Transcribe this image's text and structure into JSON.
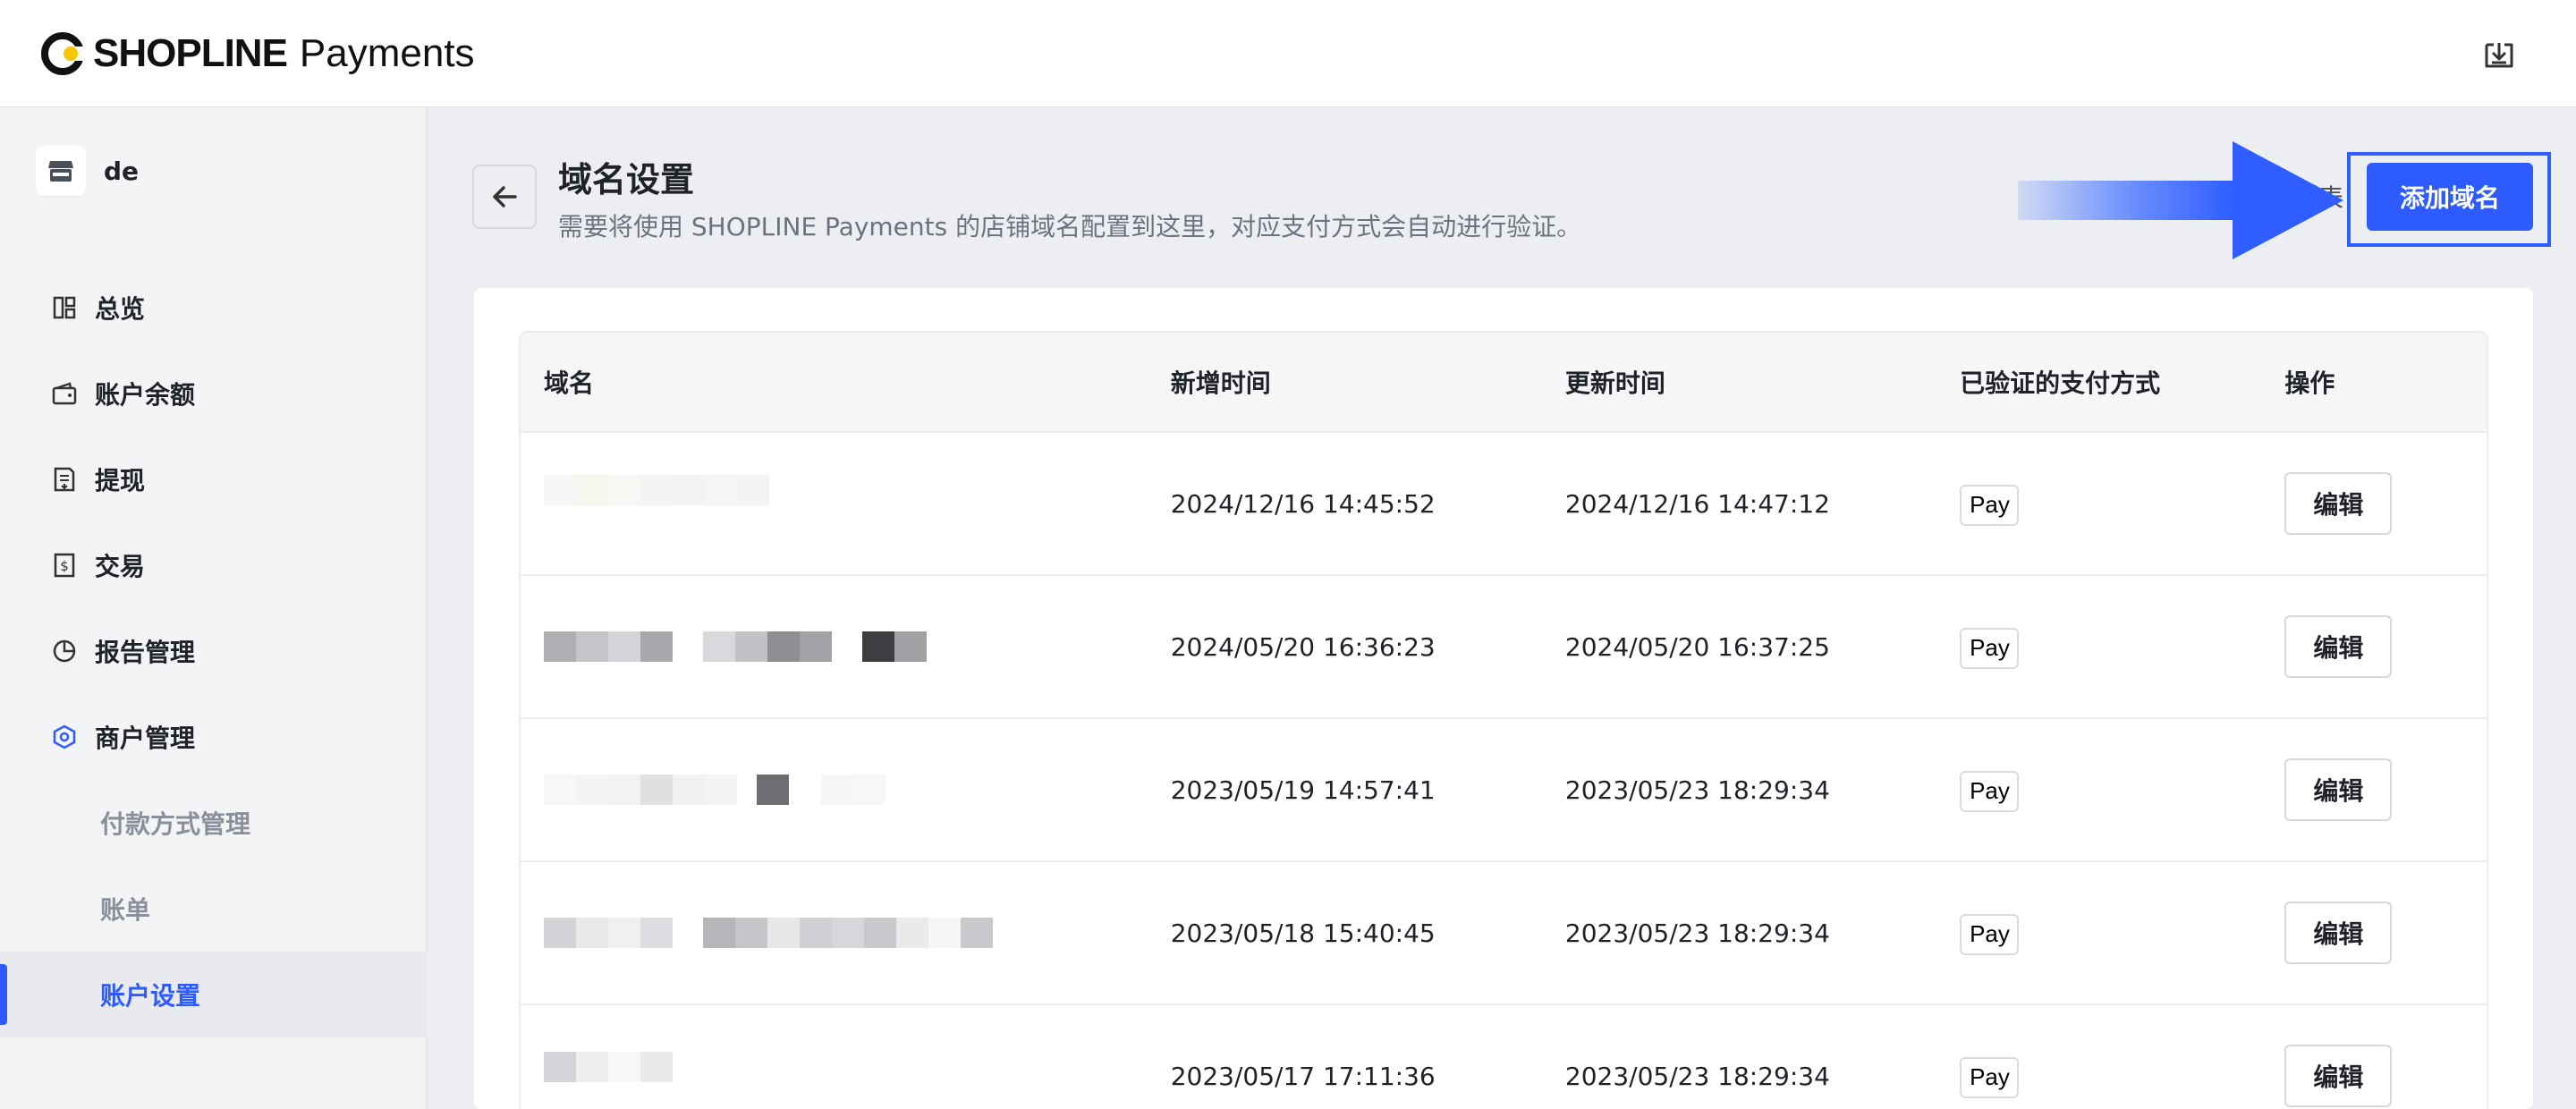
{
  "header": {
    "brand_bold": "SHOPLINE",
    "brand_light": "Payments",
    "export_icon": "download-tray-icon"
  },
  "sidebar": {
    "store_name": "de",
    "items": [
      {
        "label": "总览",
        "icon": "dashboard-icon"
      },
      {
        "label": "账户余额",
        "icon": "wallet-icon"
      },
      {
        "label": "提现",
        "icon": "withdraw-icon"
      },
      {
        "label": "交易",
        "icon": "dollar-receipt-icon"
      },
      {
        "label": "报告管理",
        "icon": "pie-chart-icon"
      },
      {
        "label": "商户管理",
        "icon": "hexagon-gear-icon"
      }
    ],
    "sub_items": [
      {
        "label": "付款方式管理"
      },
      {
        "label": "账单"
      },
      {
        "label": "账户设置",
        "active": true
      }
    ]
  },
  "page": {
    "title": "域名设置",
    "description": "需要将使用 SHOPLINE Payments 的店铺域名配置到这里，对应支付方式会自动进行验证。",
    "list_link": "F列表",
    "add_button": "添加域名"
  },
  "table": {
    "columns": [
      "域名",
      "新增时间",
      "更新时间",
      "已验证的支付方式",
      "操作"
    ],
    "rows": [
      {
        "domain": "",
        "created": "2024/12/16 14:45:52",
        "updated": "2024/12/16 14:47:12",
        "payment": "Pay",
        "action": "编辑"
      },
      {
        "domain": "",
        "created": "2024/05/20 16:36:23",
        "updated": "2024/05/20 16:37:25",
        "payment": "Pay",
        "action": "编辑"
      },
      {
        "domain": "",
        "created": "2023/05/19 14:57:41",
        "updated": "2023/05/23 18:29:34",
        "payment": "Pay",
        "action": "编辑"
      },
      {
        "domain": "",
        "created": "2023/05/18 15:40:45",
        "updated": "2023/05/23 18:29:34",
        "payment": "Pay",
        "action": "编辑"
      },
      {
        "domain": "",
        "created": "2023/05/17 17:11:36",
        "updated": "2023/05/23 18:29:34",
        "payment": "Pay",
        "action": "编辑"
      }
    ]
  },
  "colors": {
    "accent": "#2e5bff",
    "highlight_frame": "#2f5dff",
    "sidebar_bg": "#f3f4f6",
    "page_bg": "#eceef2"
  }
}
